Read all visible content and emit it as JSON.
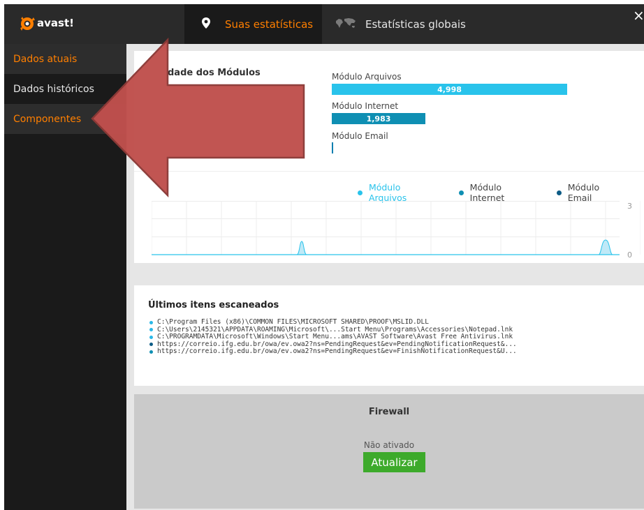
{
  "app": {
    "logo_text": "avast!",
    "close_label": "×"
  },
  "tabs": [
    {
      "label": "Suas estatísticas"
    },
    {
      "label": "Estatísticas globais"
    }
  ],
  "sidebar": {
    "items": [
      {
        "label": "Dados atuais"
      },
      {
        "label": "Dados históricos"
      },
      {
        "label": "Componentes"
      }
    ]
  },
  "modules": {
    "title": "dade dos Módulos",
    "bars": [
      {
        "label": "Módulo Arquivos",
        "value_text": "4,998",
        "value": 4998,
        "color": "#29c3eb"
      },
      {
        "label": "Módulo Internet",
        "value_text": "1,983",
        "value": 1983,
        "color": "#0f8fb3"
      },
      {
        "label": "Módulo Email",
        "value_text": "",
        "value": 0,
        "color": "#0d5c86"
      }
    ]
  },
  "chart_data": {
    "type": "area",
    "series": [
      {
        "name": "Módulo Arquivos",
        "color": "#29c3eb"
      },
      {
        "name": "Módulo Internet",
        "color": "#0f8fb3"
      },
      {
        "name": "Módulo Email",
        "color": "#0d5c86"
      }
    ],
    "ytick_labels": [
      "3",
      "0"
    ],
    "ylim": [
      0,
      3
    ],
    "grid": true,
    "legend": "top-right"
  },
  "scans": {
    "title": "Últimos itens escaneados",
    "items": [
      "C:\\Program Files (x86)\\COMMON FILES\\MICROSOFT SHARED\\PROOF\\MSLID.DLL",
      "C:\\Users\\2145321\\APPDATA\\ROAMING\\Microsoft\\...Start Menu\\Programs\\Accessories\\Notepad.lnk",
      "C:\\PROGRAMDATA\\Microsoft\\Windows\\Start Menu...ams\\AVAST Software\\Avast Free Antivirus.lnk",
      "https://correio.ifg.edu.br/owa/ev.owa2?ns=PendingRequest&ev=PendingNotificationRequest&...",
      "https://correio.ifg.edu.br/owa/ev.owa2?ns=PendingRequest&ev=FinishNotificationRequest&U..."
    ]
  },
  "firewall": {
    "title": "Firewall",
    "status": "Não ativado",
    "button": "Atualizar"
  }
}
